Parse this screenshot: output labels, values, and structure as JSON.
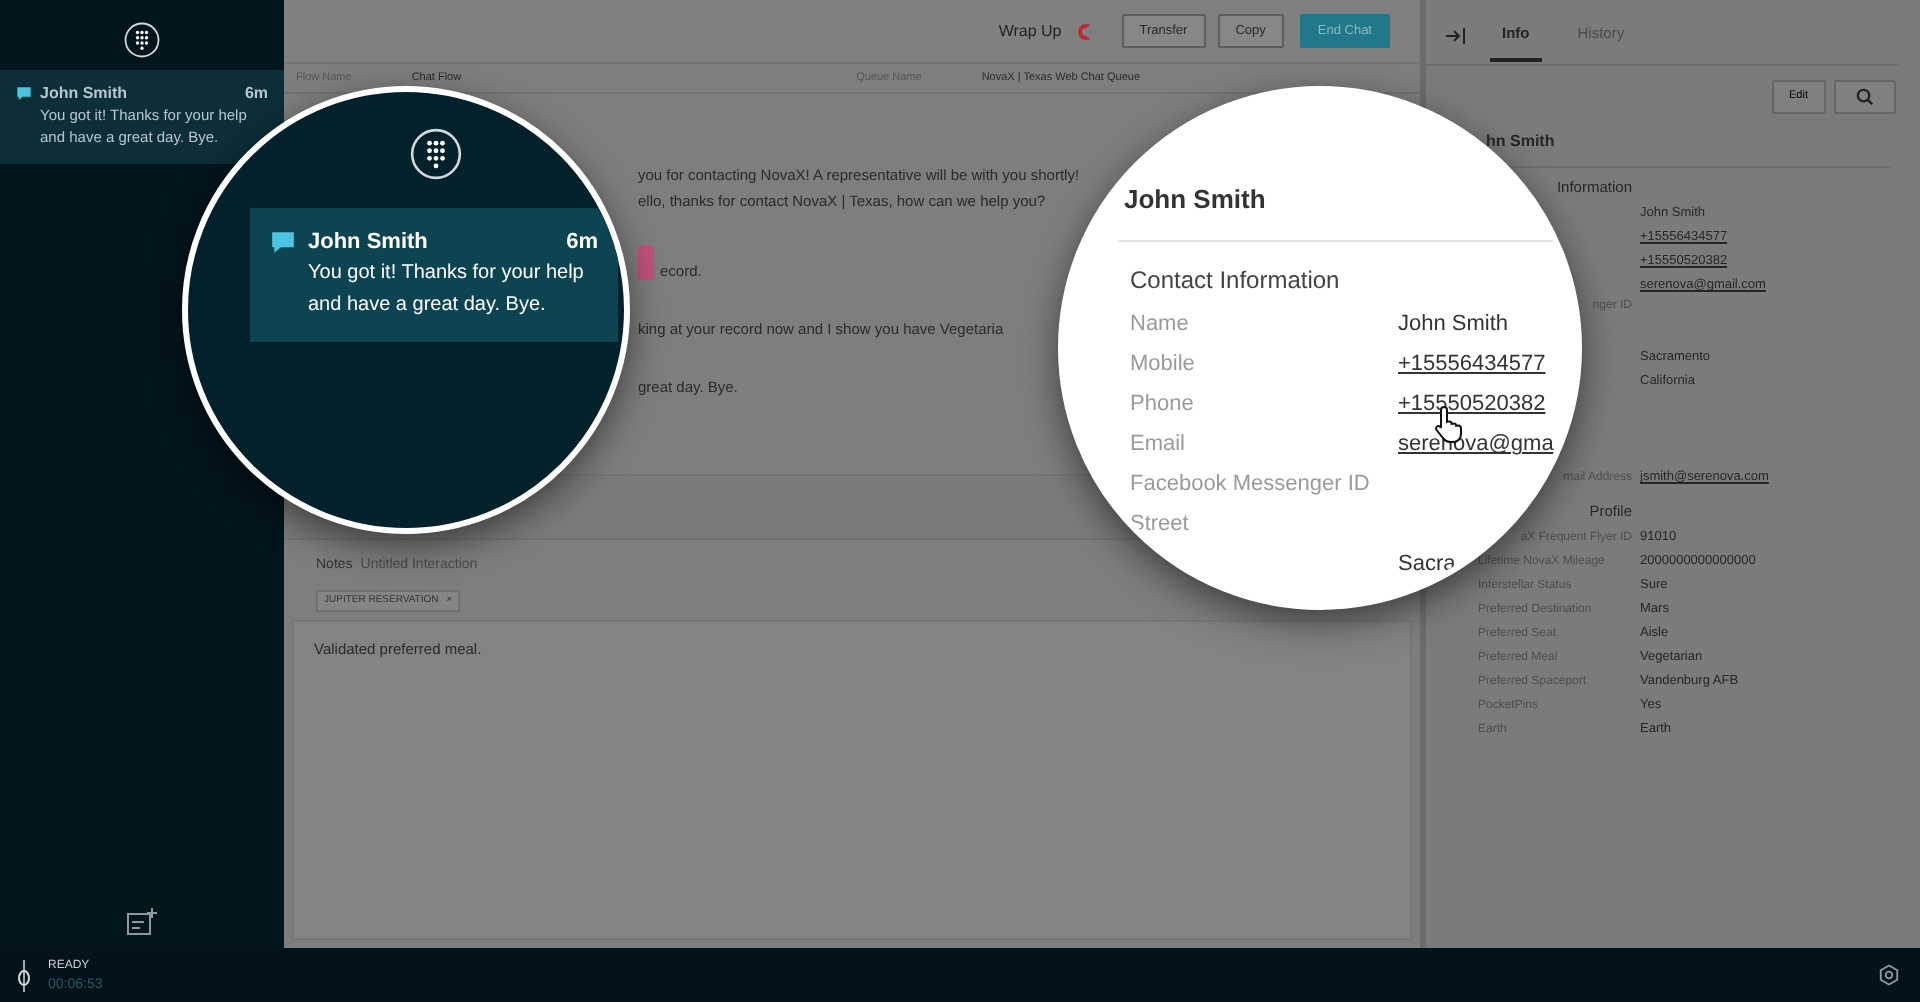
{
  "sidebar": {
    "items": [
      {
        "name": "John Smith",
        "time": "6m",
        "message": "You got it! Thanks for your help and have a great day. Bye.",
        "selected": true
      }
    ]
  },
  "header": {
    "wrap_up": "Wrap Up",
    "buttons": [
      {
        "label": "Transfer",
        "kind": "outline"
      },
      {
        "label": "Copy",
        "kind": "outline"
      },
      {
        "label": "End Chat",
        "kind": "primary"
      }
    ]
  },
  "info_row": [
    {
      "label": "Flow Name",
      "value": "Chat Flow"
    },
    {
      "label": "Queue Name",
      "value": "NovaX | Texas Web Chat Queue"
    }
  ],
  "transcript": [
    {
      "avatar": false,
      "lines": [
        "you for contacting NovaX!  A representative will be with you shortly!",
        "ello, thanks for contact NovaX | Texas, how can we help you?"
      ]
    },
    {
      "avatar": true,
      "lines": [
        "ecord."
      ]
    },
    {
      "avatar": false,
      "lines": [
        "king at your record now and I show you have Vegetaria"
      ]
    },
    {
      "avatar": false,
      "lines": [
        "great day.  Bye."
      ]
    }
  ],
  "notes": {
    "label": "Notes",
    "title": "Untitled Interaction",
    "tags": [
      {
        "label": "JUPITER RESERVATION",
        "remove": "×"
      }
    ],
    "body": "Validated preferred meal."
  },
  "right_panel": {
    "tabs": [
      {
        "label": "Info",
        "selected": true
      },
      {
        "label": "History",
        "selected": false
      }
    ],
    "buttons": [
      "Edit"
    ],
    "title": "hn Smith",
    "sections": [
      {
        "heading": "Information",
        "rows": [
          {
            "value": "John Smith",
            "link": false
          },
          {
            "value": "+15556434577",
            "link": true
          },
          {
            "value": "+15550520382",
            "link": true
          },
          {
            "value": "serenova@gmail.com",
            "link": true
          },
          {
            "label": "nger ID",
            "clipped": true
          },
          {
            "value": "Sacramento",
            "link": false
          },
          {
            "value": "California",
            "link": false
          }
        ]
      },
      {
        "rows": [
          {
            "label": "mail Address",
            "clipped": true,
            "value": "jsmith@serenova.com",
            "link": true
          }
        ]
      },
      {
        "heading": "Profile",
        "rows": [
          {
            "label": "aX Frequent Flyer ID",
            "clipped": true,
            "value": "91010",
            "link": false
          },
          {
            "label": "Lifetime NovaX Mileage",
            "value": "2000000000000000",
            "link": false
          },
          {
            "label": "Interstellar Status",
            "value": "Sure",
            "link": false
          },
          {
            "label": "Preferred Destination",
            "value": "Mars",
            "link": false
          },
          {
            "label": "Preferred Seat",
            "value": "Aisle",
            "link": false
          },
          {
            "label": "Preferred Meal",
            "value": "Vegetarian",
            "link": false
          },
          {
            "label": "Preferred Spaceport",
            "value": "Vandenburg AFB",
            "link": false
          },
          {
            "label": "PocketPins",
            "value": "Yes",
            "link": false
          },
          {
            "label": "Earth",
            "value": "Earth",
            "link": false
          }
        ]
      }
    ]
  },
  "status_bar": {
    "state": "READY",
    "timer": "00:06:53"
  },
  "magnifier_left": {
    "item": {
      "name": "John Smith",
      "time": "6m",
      "message": "You got it! Thanks for your help and have a great day. Bye.",
      "selected": true
    }
  },
  "magnifier_right": {
    "title": "John Smith",
    "section": "Contact Information",
    "rows": [
      {
        "label": "Name",
        "value": "John Smith",
        "link": false
      },
      {
        "label": "Mobile",
        "value": "+15556434577",
        "link": true
      },
      {
        "label": "Phone",
        "value": "+15550520382",
        "link": true
      },
      {
        "label": "Email",
        "value": "serenova@gma",
        "link": true
      },
      {
        "label": "Facebook Messenger ID"
      },
      {
        "label": "Street"
      },
      {
        "value": "Sacra",
        "link": false
      }
    ]
  }
}
